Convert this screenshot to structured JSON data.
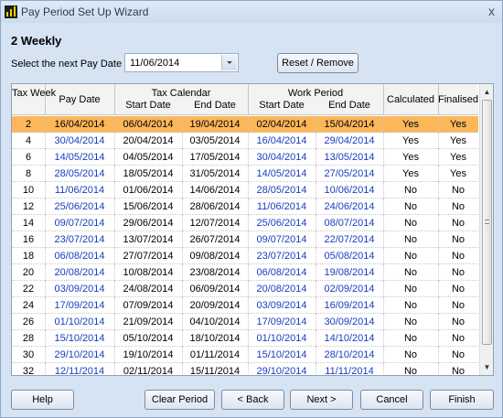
{
  "window": {
    "title": "Pay Period Set Up Wizard",
    "close_label": "x"
  },
  "section_title": "2 Weekly",
  "pay_date": {
    "label": "Select the next Pay Date",
    "value": "11/06/2014"
  },
  "buttons": {
    "reset": "Reset / Remove",
    "help": "Help",
    "clear_period": "Clear Period",
    "back": "< Back",
    "next": "Next >",
    "cancel": "Cancel",
    "finish": "Finish"
  },
  "table": {
    "headers": {
      "tax_week": "Tax Week",
      "pay_date": "Pay Date",
      "tax_calendar": "Tax Calendar",
      "work_period": "Work Period",
      "start_date": "Start Date",
      "end_date": "End Date",
      "calculated": "Calculated",
      "finalised": "Finalised"
    },
    "selected_index": 0,
    "rows": [
      {
        "week": "2",
        "pay": "16/04/2014",
        "tax_start": "06/04/2014",
        "tax_end": "19/04/2014",
        "work_start": "02/04/2014",
        "work_end": "15/04/2014",
        "calculated": "Yes",
        "finalised": "Yes"
      },
      {
        "week": "4",
        "pay": "30/04/2014",
        "tax_start": "20/04/2014",
        "tax_end": "03/05/2014",
        "work_start": "16/04/2014",
        "work_end": "29/04/2014",
        "calculated": "Yes",
        "finalised": "Yes"
      },
      {
        "week": "6",
        "pay": "14/05/2014",
        "tax_start": "04/05/2014",
        "tax_end": "17/05/2014",
        "work_start": "30/04/2014",
        "work_end": "13/05/2014",
        "calculated": "Yes",
        "finalised": "Yes"
      },
      {
        "week": "8",
        "pay": "28/05/2014",
        "tax_start": "18/05/2014",
        "tax_end": "31/05/2014",
        "work_start": "14/05/2014",
        "work_end": "27/05/2014",
        "calculated": "Yes",
        "finalised": "Yes"
      },
      {
        "week": "10",
        "pay": "11/06/2014",
        "tax_start": "01/06/2014",
        "tax_end": "14/06/2014",
        "work_start": "28/05/2014",
        "work_end": "10/06/2014",
        "calculated": "No",
        "finalised": "No"
      },
      {
        "week": "12",
        "pay": "25/06/2014",
        "tax_start": "15/06/2014",
        "tax_end": "28/06/2014",
        "work_start": "11/06/2014",
        "work_end": "24/06/2014",
        "calculated": "No",
        "finalised": "No"
      },
      {
        "week": "14",
        "pay": "09/07/2014",
        "tax_start": "29/06/2014",
        "tax_end": "12/07/2014",
        "work_start": "25/06/2014",
        "work_end": "08/07/2014",
        "calculated": "No",
        "finalised": "No"
      },
      {
        "week": "16",
        "pay": "23/07/2014",
        "tax_start": "13/07/2014",
        "tax_end": "26/07/2014",
        "work_start": "09/07/2014",
        "work_end": "22/07/2014",
        "calculated": "No",
        "finalised": "No"
      },
      {
        "week": "18",
        "pay": "06/08/2014",
        "tax_start": "27/07/2014",
        "tax_end": "09/08/2014",
        "work_start": "23/07/2014",
        "work_end": "05/08/2014",
        "calculated": "No",
        "finalised": "No"
      },
      {
        "week": "20",
        "pay": "20/08/2014",
        "tax_start": "10/08/2014",
        "tax_end": "23/08/2014",
        "work_start": "06/08/2014",
        "work_end": "19/08/2014",
        "calculated": "No",
        "finalised": "No"
      },
      {
        "week": "22",
        "pay": "03/09/2014",
        "tax_start": "24/08/2014",
        "tax_end": "06/09/2014",
        "work_start": "20/08/2014",
        "work_end": "02/09/2014",
        "calculated": "No",
        "finalised": "No"
      },
      {
        "week": "24",
        "pay": "17/09/2014",
        "tax_start": "07/09/2014",
        "tax_end": "20/09/2014",
        "work_start": "03/09/2014",
        "work_end": "16/09/2014",
        "calculated": "No",
        "finalised": "No"
      },
      {
        "week": "26",
        "pay": "01/10/2014",
        "tax_start": "21/09/2014",
        "tax_end": "04/10/2014",
        "work_start": "17/09/2014",
        "work_end": "30/09/2014",
        "calculated": "No",
        "finalised": "No"
      },
      {
        "week": "28",
        "pay": "15/10/2014",
        "tax_start": "05/10/2014",
        "tax_end": "18/10/2014",
        "work_start": "01/10/2014",
        "work_end": "14/10/2014",
        "calculated": "No",
        "finalised": "No"
      },
      {
        "week": "30",
        "pay": "29/10/2014",
        "tax_start": "19/10/2014",
        "tax_end": "01/11/2014",
        "work_start": "15/10/2014",
        "work_end": "28/10/2014",
        "calculated": "No",
        "finalised": "No"
      },
      {
        "week": "32",
        "pay": "12/11/2014",
        "tax_start": "02/11/2014",
        "tax_end": "15/11/2014",
        "work_start": "29/10/2014",
        "work_end": "11/11/2014",
        "calculated": "No",
        "finalised": "No"
      }
    ]
  }
}
